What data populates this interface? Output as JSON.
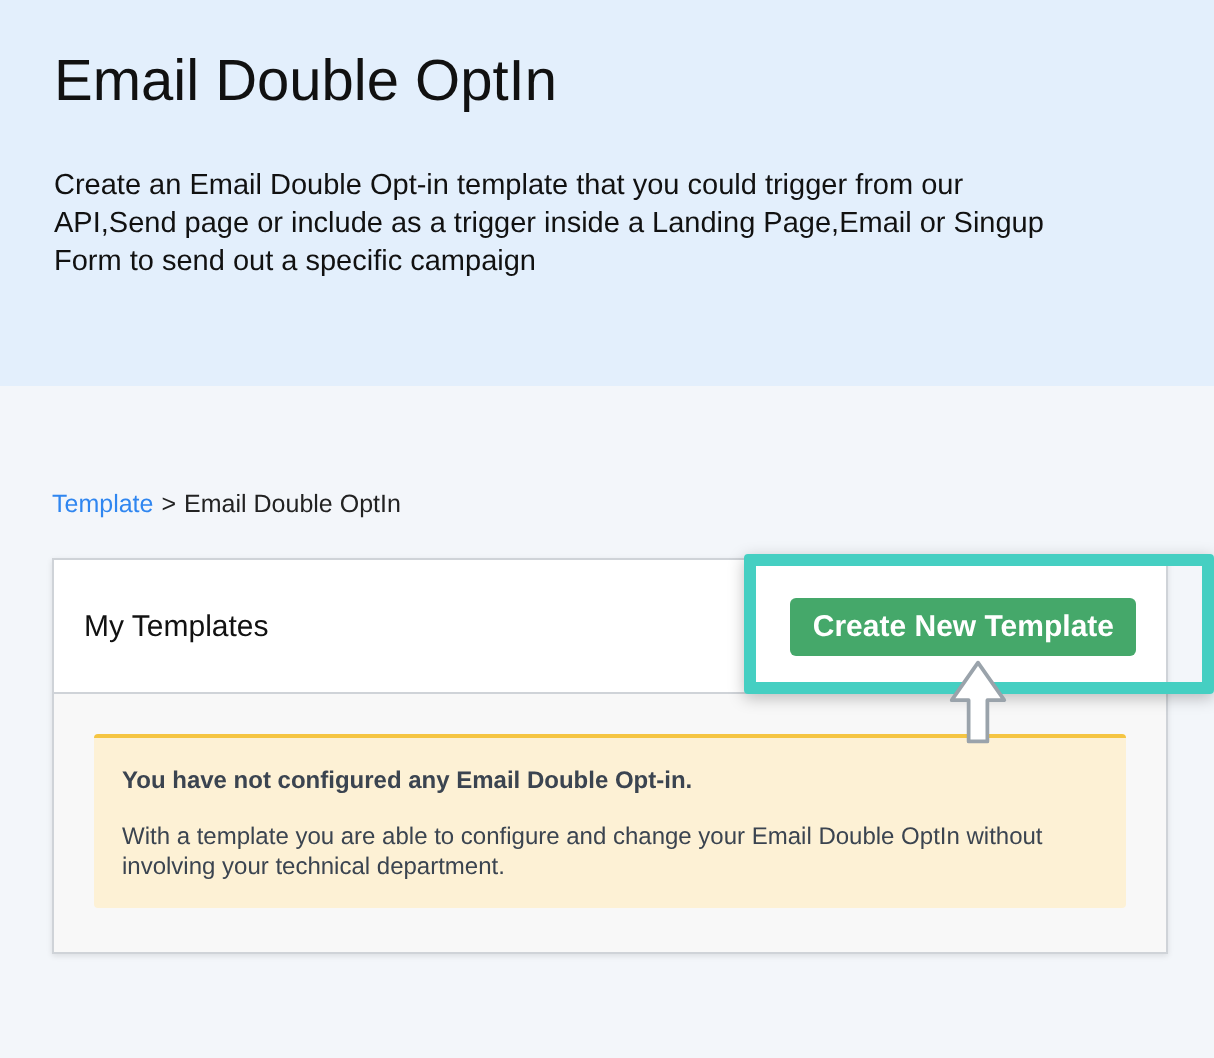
{
  "header": {
    "title": "Email Double OptIn",
    "description": "Create an Email Double Opt-in template that you could trigger from our API,Send page or include as a trigger inside a Landing Page,Email or Singup Form to send out a specific campaign"
  },
  "breadcrumb": [
    {
      "label": "Template",
      "kind": "link"
    },
    {
      "label": ">",
      "kind": "separator"
    },
    {
      "label": "Email Double OptIn",
      "kind": "current"
    }
  ],
  "card": {
    "title": "My Templates",
    "button": "Create New Template",
    "highlighted": true,
    "notice": {
      "heading": "You have not configured any Email Double Opt-in.",
      "body": "With a template you are able to configure and change your Email Double OptIn without involving your technical department."
    }
  }
}
